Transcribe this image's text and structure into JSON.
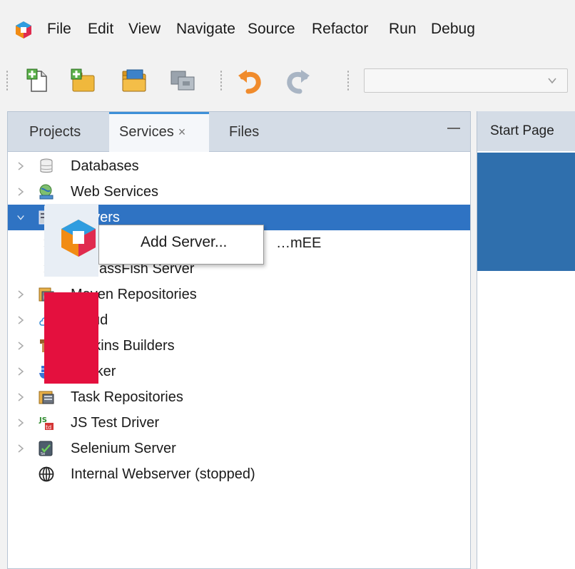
{
  "menubar": {
    "items": [
      "File",
      "Edit",
      "View",
      "Navigate",
      "Source",
      "Refactor",
      "Run",
      "Debug"
    ]
  },
  "toolbar": {
    "icons": [
      "new-file-icon",
      "new-project-icon",
      "open-project-icon",
      "close-project-icon",
      "undo-icon",
      "redo-icon"
    ],
    "config_value": ""
  },
  "left_panel": {
    "tabs": [
      {
        "label": "Projects"
      },
      {
        "label": "Services",
        "close": "×",
        "active": true
      },
      {
        "label": "Files"
      }
    ],
    "tree": [
      {
        "label": "Databases",
        "icon": "database-icon",
        "expanded": false
      },
      {
        "label": "Web Services",
        "icon": "web-services-icon",
        "expanded": false
      },
      {
        "label": "Servers",
        "icon": "servers-icon",
        "expanded": true,
        "selected": true
      },
      {
        "label": "…mEE",
        "icon": "payara-icon",
        "child": true
      },
      {
        "label": "GlassFish Server",
        "icon": "glassfish-icon",
        "child": true
      },
      {
        "label": "Maven Repositories",
        "icon": "maven-icon",
        "expanded": false
      },
      {
        "label": "Cloud",
        "icon": "cloud-icon",
        "expanded": false
      },
      {
        "label": "Jenkins Builders",
        "icon": "jenkins-icon",
        "expanded": false
      },
      {
        "label": "Docker",
        "icon": "docker-icon",
        "expanded": false
      },
      {
        "label": "Task Repositories",
        "icon": "task-repository-icon",
        "expanded": false
      },
      {
        "label": "JS Test Driver",
        "icon": "js-test-driver-icon",
        "expanded": false
      },
      {
        "label": "Selenium Server",
        "icon": "selenium-icon",
        "expanded": false
      },
      {
        "label": "Internal Webserver (stopped)",
        "icon": "globe-icon",
        "expanded": null
      }
    ]
  },
  "context_menu": {
    "items": [
      "Add Server..."
    ]
  },
  "right_panel": {
    "tab_label": "Start Page",
    "colors": {
      "banner": "#2f6fad",
      "accent": "#e4103e"
    }
  },
  "colors": {
    "selection": "#2f73c3",
    "tab_accent": "#3d8fd8",
    "tabbar_bg": "#d4dce6"
  }
}
